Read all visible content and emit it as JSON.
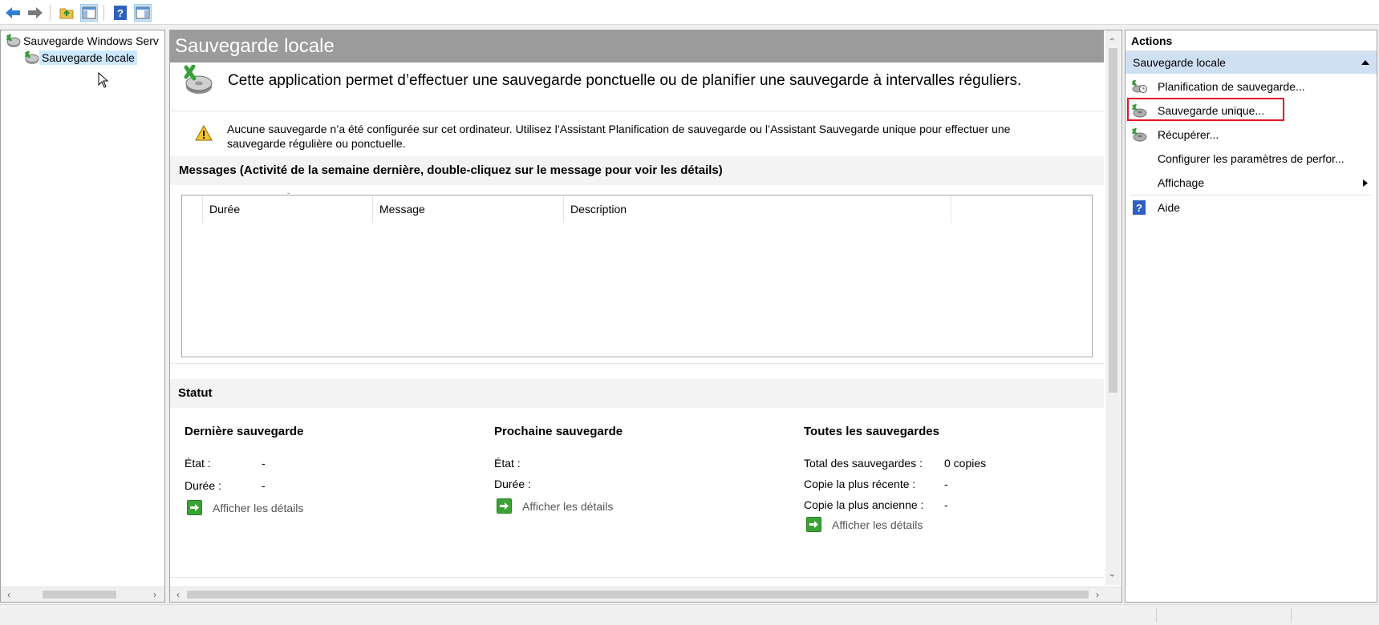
{
  "toolbar": {
    "buttons": [
      "back-arrow-icon",
      "forward-arrow-icon",
      "up-folder-icon",
      "show-hide-console-tree-icon",
      "help-icon",
      "show-hide-action-pane-icon"
    ]
  },
  "tree": {
    "root_label": "Sauvegarde Windows Serv",
    "child_label": "Sauvegarde locale"
  },
  "center": {
    "title": "Sauvegarde locale",
    "intro": "Cette application permet d’effectuer une sauvegarde ponctuelle ou de planifier une sauvegarde à intervalles réguliers.",
    "warning_line1": "Aucune sauvegarde n’a été configurée sur cet ordinateur. Utilisez l’Assistant Planification de sauvegarde ou l’Assistant Sauvegarde unique pour effectuer une",
    "warning_line2": "sauvegarde régulière ou ponctuelle.",
    "messages_header": "Messages (Activité de la semaine dernière, double-cliquez sur le message pour voir les détails)",
    "columns": [
      "Durée",
      "Message",
      "Description"
    ],
    "status_header": "Statut",
    "last": {
      "title": "Dernière sauvegarde",
      "state_label": "État :",
      "state_value": "-",
      "duration_label": "Durée :",
      "duration_value": "-",
      "details": "Afficher les détails"
    },
    "next": {
      "title": "Prochaine sauvegarde",
      "state_label": "État :",
      "duration_label": "Durée :",
      "details": "Afficher les détails"
    },
    "all": {
      "title": "Toutes les sauvegardes",
      "total_label": "Total des sauvegardes :",
      "total_value": "0 copies",
      "recent_label": "Copie la plus récente :",
      "recent_value": "-",
      "oldest_label": "Copie la plus ancienne :",
      "oldest_value": "-",
      "details": "Afficher les détails"
    }
  },
  "actions": {
    "header": "Actions",
    "section": "Sauvegarde locale",
    "items": [
      {
        "label": "Planification de sauvegarde...",
        "icon": "schedule-backup-icon"
      },
      {
        "label": "Sauvegarde unique...",
        "icon": "backup-once-icon",
        "highlighted": true
      },
      {
        "label": "Récupérer...",
        "icon": "recover-icon"
      },
      {
        "label": "Configurer les paramètres de perfor...",
        "icon": ""
      },
      {
        "label": "Affichage",
        "icon": "",
        "submenu": true
      },
      {
        "label": "Aide",
        "icon": "help-icon"
      }
    ],
    "highlight_color": "#e81123"
  },
  "colors": {
    "title_bar": "#9b9b9b",
    "selection": "#cce8ff",
    "actions_section": "#cfe0f5"
  }
}
